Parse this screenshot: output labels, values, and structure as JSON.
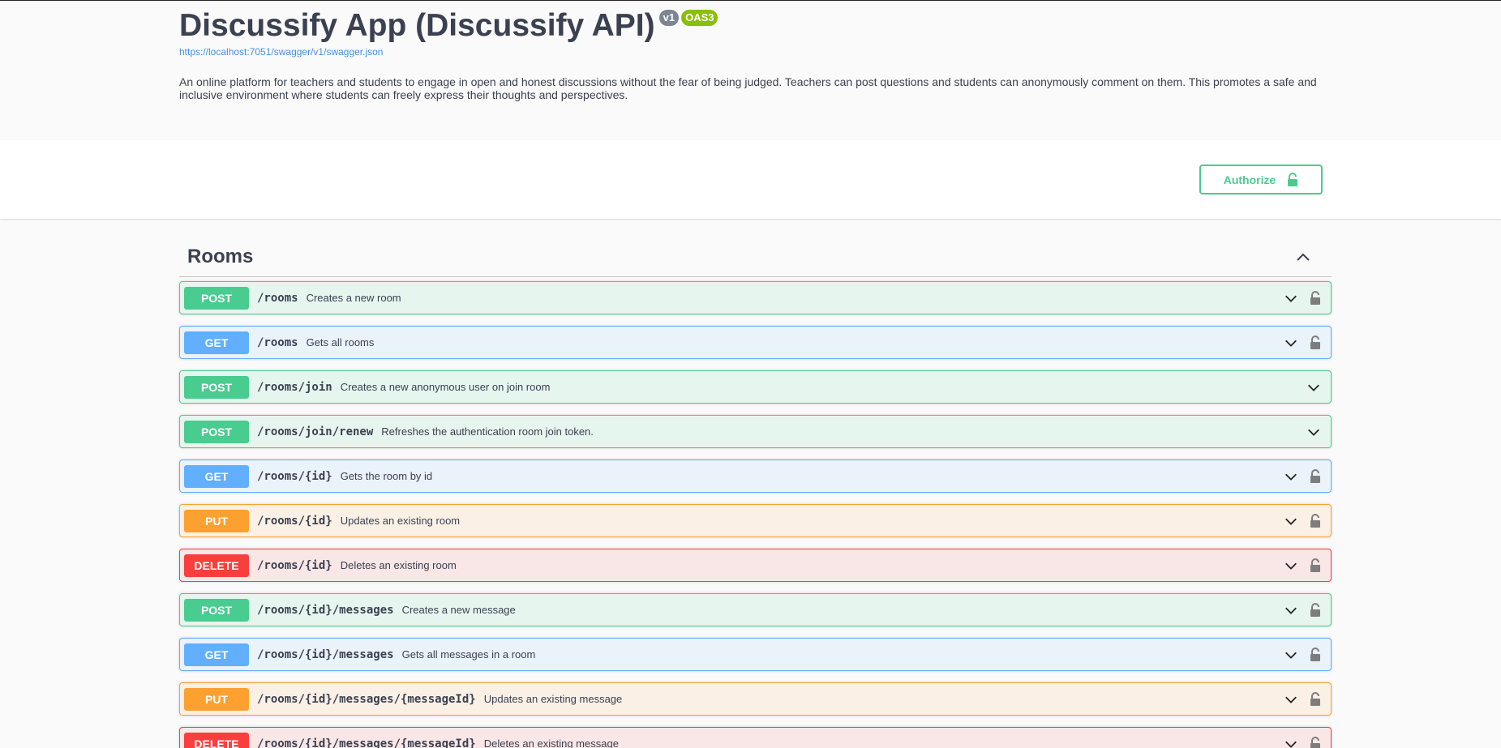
{
  "info": {
    "title": "Discussify App (Discussify API)",
    "version_badge": "v1",
    "oas_badge": "OAS3",
    "spec_url": "https://localhost:7051/swagger/v1/swagger.json",
    "description": "An online platform for teachers and students to engage in open and honest discussions without the fear of being judged. Teachers can post questions and students can anonymously comment on them. This promotes a safe and inclusive environment where students can freely express their thoughts and perspectives."
  },
  "auth": {
    "authorize_label": "Authorize"
  },
  "tag": {
    "name": "Rooms"
  },
  "operations": [
    {
      "method": "POST",
      "path": "/rooms",
      "summary": "Creates a new room",
      "locked": true
    },
    {
      "method": "GET",
      "path": "/rooms",
      "summary": "Gets all rooms",
      "locked": true
    },
    {
      "method": "POST",
      "path": "/rooms/join",
      "summary": "Creates a new anonymous user on join room",
      "locked": false
    },
    {
      "method": "POST",
      "path": "/rooms/join/renew",
      "summary": "Refreshes the authentication room join token.",
      "locked": false
    },
    {
      "method": "GET",
      "path": "/rooms/{id}",
      "summary": "Gets the room by id",
      "locked": true
    },
    {
      "method": "PUT",
      "path": "/rooms/{id}",
      "summary": "Updates an existing room",
      "locked": true
    },
    {
      "method": "DELETE",
      "path": "/rooms/{id}",
      "summary": "Deletes an existing room",
      "locked": true
    },
    {
      "method": "POST",
      "path": "/rooms/{id}/messages",
      "summary": "Creates a new message",
      "locked": true
    },
    {
      "method": "GET",
      "path": "/rooms/{id}/messages",
      "summary": "Gets all messages in a room",
      "locked": true
    },
    {
      "method": "PUT",
      "path": "/rooms/{id}/messages/{messageId}",
      "summary": "Updates an existing message",
      "locked": true
    },
    {
      "method": "DELETE",
      "path": "/rooms/{id}/messages/{messageId}",
      "summary": "Deletes an existing message",
      "locked": true
    }
  ],
  "colors": {
    "post": "#49cc90",
    "get": "#61affe",
    "put": "#fca130",
    "delete": "#f93e3e",
    "text": "#3b4151",
    "link": "#4990e2"
  },
  "icons": {
    "lock": "lock-icon",
    "unlock": "unlock-icon",
    "expand": "chevron-down-icon",
    "collapse": "chevron-up-icon"
  }
}
